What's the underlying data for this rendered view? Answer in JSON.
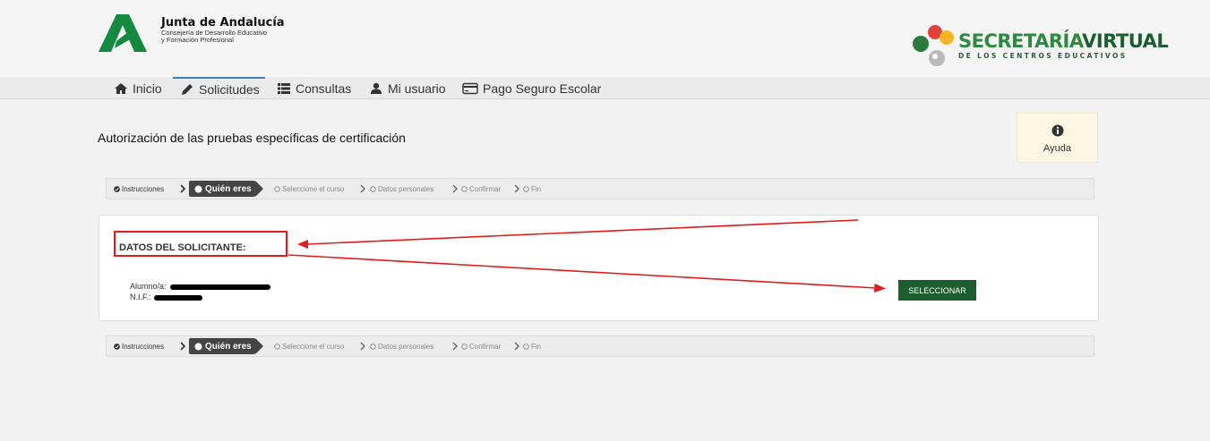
{
  "header": {
    "org_name": "Junta de Andalucía",
    "org_sub_line1": "Consejería de Desarrollo Educativo",
    "org_sub_line2": "y Formación Profesional",
    "app_title_part1": "SECRETARÍA",
    "app_title_part2": "VIRTUAL",
    "app_subtitle": "DE LOS CENTROS EDUCATIVOS"
  },
  "nav": {
    "items": [
      {
        "label": "Inicio",
        "icon": "home-icon"
      },
      {
        "label": "Solicitudes",
        "icon": "pencil-icon",
        "active": true
      },
      {
        "label": "Consultas",
        "icon": "list-icon"
      },
      {
        "label": "Mi usuario",
        "icon": "user-icon"
      },
      {
        "label": "Pago Seguro Escolar",
        "icon": "credit-card-icon"
      }
    ]
  },
  "page": {
    "title": "Autorización de las pruebas específicas de certificación",
    "help_label": "Ayuda"
  },
  "stepper": {
    "steps": [
      "Instrucciones",
      "Quién eres",
      "Seleccione el curso",
      "Datos personales",
      "Confirmar",
      "Fin"
    ]
  },
  "card": {
    "section_title": "DATOS DEL SOLICITANTE:",
    "student_label": "Alumno/a:",
    "nif_label": "N.I.F.:",
    "select_button": "SELECCIONAR"
  },
  "colors": {
    "primary_green": "#1c5e2d",
    "annotation_red": "#e01b1b",
    "nav_active": "#3c7fc4"
  }
}
